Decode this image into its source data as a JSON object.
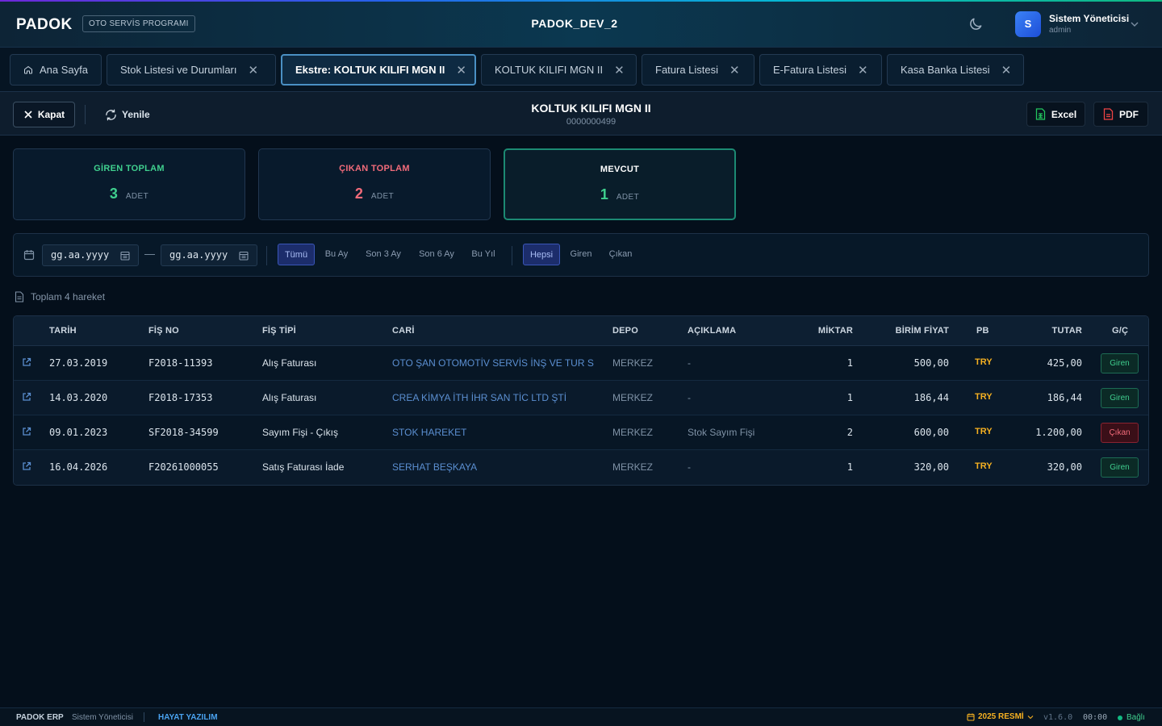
{
  "header": {
    "logo": "PADOK",
    "program_tag": "OTO SERVİS PROGRAMI",
    "app_title": "PADOK_DEV_2",
    "user": {
      "initial": "S",
      "name": "Sistem Yöneticisi",
      "role": "admin"
    }
  },
  "tabs": [
    {
      "label": "Ana Sayfa",
      "closable": false,
      "icon": "home-icon"
    },
    {
      "label": "Stok Listesi ve Durumları",
      "closable": true
    },
    {
      "label": "Ekstre: KOLTUK KILIFI MGN II",
      "closable": true,
      "active": true
    },
    {
      "label": "KOLTUK KILIFI MGN II",
      "closable": true
    },
    {
      "label": "Fatura Listesi",
      "closable": true
    },
    {
      "label": "E-Fatura Listesi",
      "closable": true
    },
    {
      "label": "Kasa Banka Listesi",
      "closable": true
    }
  ],
  "toolbar": {
    "close_label": "Kapat",
    "refresh_label": "Yenile",
    "title": "KOLTUK KILIFI MGN II",
    "code": "0000000499",
    "excel_label": "Excel",
    "pdf_label": "PDF"
  },
  "summary": {
    "in": {
      "label": "GİREN TOPLAM",
      "value": "3",
      "unit": "ADET",
      "color": "#3fcf8e"
    },
    "out": {
      "label": "ÇIKAN TOPLAM",
      "value": "2",
      "unit": "ADET",
      "color": "#f26b7a"
    },
    "current": {
      "label": "MEVCUT",
      "value": "1",
      "unit": "ADET",
      "color": "#3fcf8e"
    }
  },
  "filters": {
    "date_start_placeholder": "gg.aa.yyyy",
    "date_end_placeholder": "gg.aa.yyyy",
    "date_separator": "—",
    "periods": [
      "Tümü",
      "Bu Ay",
      "Son 3 Ay",
      "Son 6 Ay",
      "Bu Yıl"
    ],
    "period_selected": "Tümü",
    "types": [
      "Hepsi",
      "Giren",
      "Çıkan"
    ],
    "type_selected": "Hepsi"
  },
  "count_text": "Toplam 4 hareket",
  "table": {
    "columns": [
      "TARİH",
      "FİŞ NO",
      "FİŞ TİPİ",
      "CARİ",
      "DEPO",
      "AÇIKLAMA",
      "MİKTAR",
      "BİRİM FİYAT",
      "PB",
      "TUTAR",
      "G/Ç"
    ],
    "rows": [
      {
        "date": "27.03.2019",
        "doc_no": "F2018-11393",
        "doc_type": "Alış Faturası",
        "account": "OTO ŞAN OTOMOTİV SERVİS İNŞ VE TUR SA...",
        "depot": "MERKEZ",
        "desc": "-",
        "qty": "1",
        "unit_price": "500,00",
        "currency": "TRY",
        "total": "425,00",
        "direction": "Giren"
      },
      {
        "date": "14.03.2020",
        "doc_no": "F2018-17353",
        "doc_type": "Alış Faturası",
        "account": "CREA KİMYA İTH İHR SAN TİC LTD ŞTİ",
        "depot": "MERKEZ",
        "desc": "-",
        "qty": "1",
        "unit_price": "186,44",
        "currency": "TRY",
        "total": "186,44",
        "direction": "Giren"
      },
      {
        "date": "09.01.2023",
        "doc_no": "SF2018-34599",
        "doc_type": "Sayım Fişi - Çıkış",
        "account": "STOK HAREKET",
        "depot": "MERKEZ",
        "desc": "Stok Sayım Fişi",
        "qty": "2",
        "unit_price": "600,00",
        "currency": "TRY",
        "total": "1.200,00",
        "direction": "Çıkan"
      },
      {
        "date": "16.04.2026",
        "doc_no": "F20261000055",
        "doc_type": "Satış Faturası İade",
        "account": "SERHAT BEŞKAYA",
        "depot": "MERKEZ",
        "desc": "-",
        "qty": "1",
        "unit_price": "320,00",
        "currency": "TRY",
        "total": "320,00",
        "direction": "Giren"
      }
    ]
  },
  "footer": {
    "brand": "PADOK ERP",
    "user": "Sistem Yöneticisi",
    "company": "HAYAT YAZILIM",
    "year": "2025 RESMİ",
    "version": "v1.6.0",
    "time": "00:00",
    "status": "Bağlı"
  }
}
